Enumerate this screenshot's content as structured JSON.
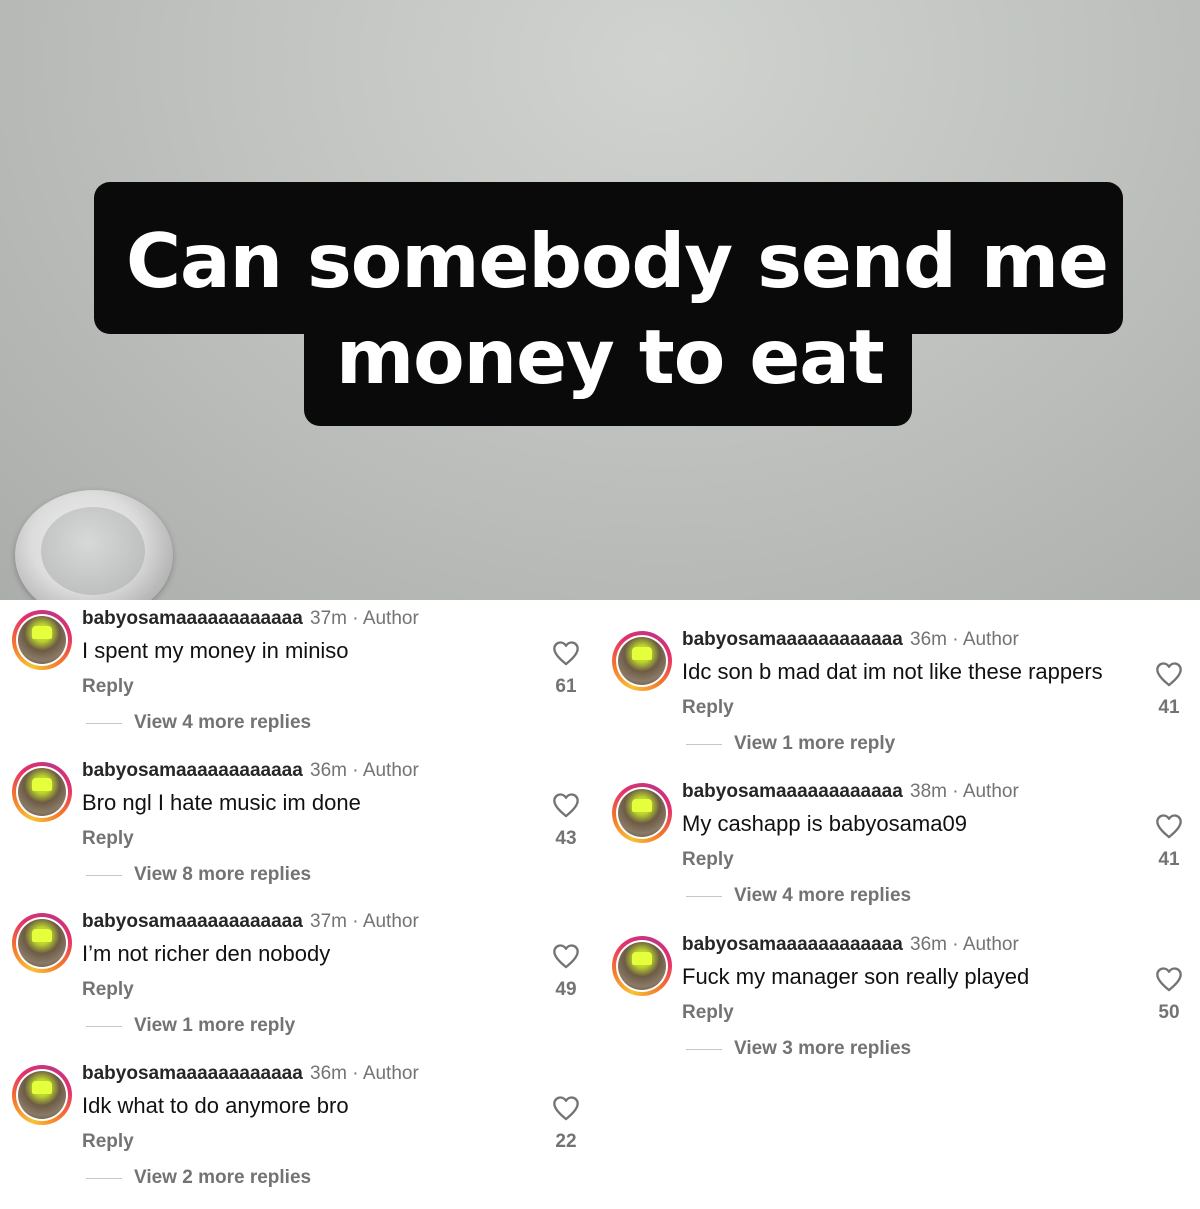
{
  "caption": {
    "line1": "Can somebody send me",
    "line2": "money to eat"
  },
  "comments_left": [
    {
      "username": "babyosamaaaaaaaaaaaa",
      "time": "37m",
      "author_tag": "Author",
      "text": "I spent my money in miniso",
      "reply_label": "Reply",
      "likes": "61",
      "more_replies": "View 4 more replies"
    },
    {
      "username": "babyosamaaaaaaaaaaaa",
      "time": "36m",
      "author_tag": "Author",
      "text": "Bro ngl I hate music im done",
      "reply_label": "Reply",
      "likes": "43",
      "more_replies": "View 8 more replies"
    },
    {
      "username": "babyosamaaaaaaaaaaaa",
      "time": "37m",
      "author_tag": "Author",
      "text": "I’m not richer den nobody",
      "reply_label": "Reply",
      "likes": "49",
      "more_replies": "View 1 more reply"
    },
    {
      "username": "babyosamaaaaaaaaaaaa",
      "time": "36m",
      "author_tag": "Author",
      "text": "Idk what to do anymore bro",
      "reply_label": "Reply",
      "likes": "22",
      "more_replies": "View 2 more replies"
    }
  ],
  "comments_right": [
    {
      "username": "babyosamaaaaaaaaaaaa",
      "time": "36m",
      "author_tag": "Author",
      "text": "Idc son b mad dat im not like these rappers",
      "reply_label": "Reply",
      "likes": "41",
      "more_replies": "View 1 more reply"
    },
    {
      "username": "babyosamaaaaaaaaaaaa",
      "time": "38m",
      "author_tag": "Author",
      "text": "My cashapp is babyosama09",
      "reply_label": "Reply",
      "likes": "41",
      "more_replies": "View 4 more replies"
    },
    {
      "username": "babyosamaaaaaaaaaaaa",
      "time": "36m",
      "author_tag": "Author",
      "text": "Fuck my manager son really played",
      "reply_label": "Reply",
      "likes": "50",
      "more_replies": "View 3 more replies"
    }
  ],
  "separator": "·",
  "icons": {
    "like": "heart-outline-icon",
    "avatar": "profile-avatar"
  },
  "colors": {
    "ring_start": "#f9c235",
    "ring_end": "#c13584",
    "text_primary": "#262626",
    "text_secondary": "#737373"
  }
}
